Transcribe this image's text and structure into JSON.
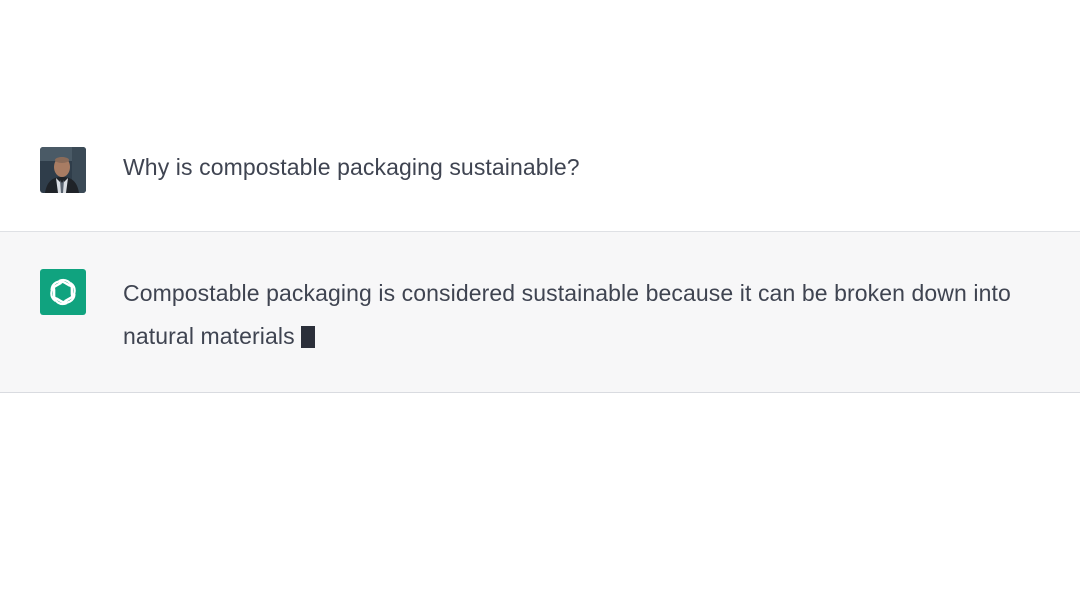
{
  "conversation": {
    "user_message": {
      "text": "Why is compostable packaging sustainable?",
      "avatar_icon": "user-photo-avatar"
    },
    "assistant_message": {
      "text": "Compostable packaging is considered sustainable because it can be broken down into natural materials",
      "avatar_icon": "openai-logo-icon",
      "streaming_cursor": true
    }
  },
  "colors": {
    "assistant_row_bg": "#f7f7f8",
    "logo_bg": "#10a37f",
    "text": "#3f4451"
  }
}
